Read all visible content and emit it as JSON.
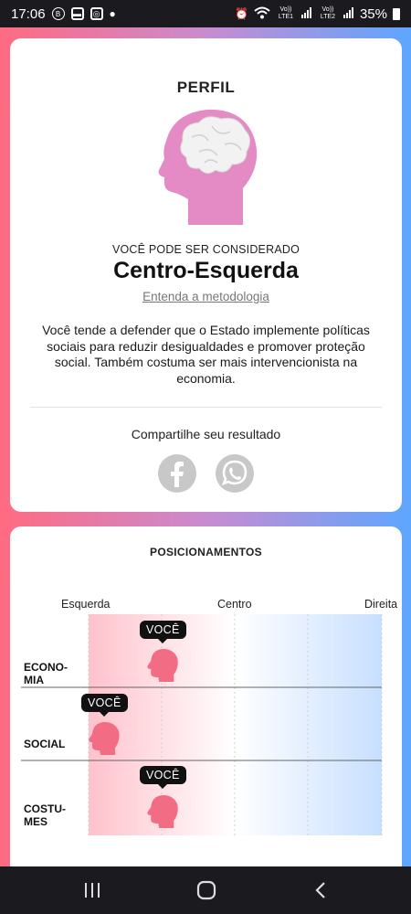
{
  "status_bar": {
    "time": "17:06",
    "battery": "35%",
    "sim1": "Vo)) LTE1",
    "sim2": "Vo)) LTE2",
    "icons": [
      "b-icon",
      "message-icon",
      "instagram-icon",
      "dot-icon",
      "alarm-icon",
      "wifi-icon",
      "signal-icon",
      "battery-icon"
    ]
  },
  "profile": {
    "title": "PERFIL",
    "subheading": "VOCÊ PODE SER CONSIDERADO",
    "result": "Centro-Esquerda",
    "methodology_link": "Entenda a metodologia",
    "description": "Você tende a defender que o Estado implemente políticas sociais para reduzir desigualdades e promover proteção social. Também costuma ser mais intervencionista na economia.",
    "share_label": "Compartilhe seu resultado",
    "share_buttons": [
      "facebook-icon",
      "whatsapp-icon"
    ],
    "head_color": "#e48ac5"
  },
  "positions": {
    "title": "POSICIONAMENTOS",
    "axis": {
      "left": "Esquerda",
      "center": "Centro",
      "right": "Direita"
    },
    "you_label": "VOCÊ",
    "rows": [
      {
        "label_line1": "ECONO-",
        "label_line2": "MIA",
        "value": 0.25
      },
      {
        "label_line1": "SOCIAL",
        "label_line2": "",
        "value": 0.05
      },
      {
        "label_line1": "COSTU-",
        "label_line2": "MES",
        "value": 0.25
      }
    ],
    "colors": {
      "left": "#ffc2cc",
      "right": "#c7dfff",
      "marker": "#f26d84"
    }
  }
}
